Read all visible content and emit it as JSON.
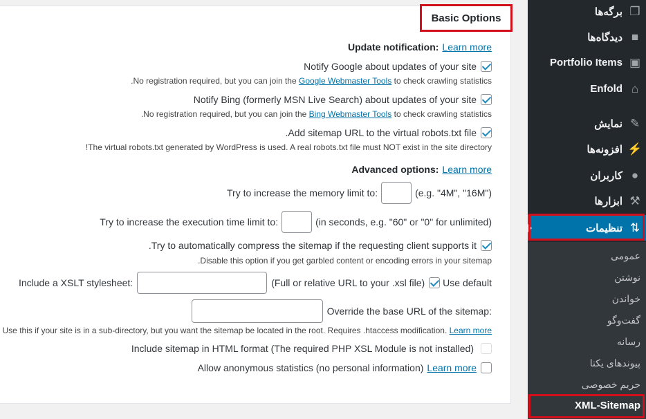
{
  "section_title": "Basic Options",
  "update_notification": {
    "heading": "Update notification:",
    "learn_more": "Learn more",
    "google_label": "Notify Google about updates of your site",
    "google_help_pre": ".No registration required, but you can join the ",
    "google_help_link": "Google Webmaster Tools",
    "google_help_post": " to check crawling statistics",
    "bing_label": "Notify Bing (formerly MSN Live Search) about updates of your site",
    "bing_help_pre": ".No registration required, but you can join the ",
    "bing_help_link": "Bing Webmaster Tools",
    "bing_help_post": " to check crawling statistics",
    "robots_label": ".Add sitemap URL to the virtual robots.txt file",
    "robots_help": "!The virtual robots.txt generated by WordPress is used. A real robots.txt file must NOT exist in the site directory"
  },
  "advanced_options": {
    "heading": "Advanced options:",
    "learn_more": "Learn more",
    "memory_label": "Try to increase the memory limit to:",
    "memory_hint": "(e.g. \"4M\", \"16M\")",
    "memory_value": "",
    "time_label": "Try to increase the execution time limit to:",
    "time_hint": "(in seconds, e.g. \"60\" or \"0\" for unlimited)",
    "time_value": "",
    "compress_label": ".Try to automatically compress the sitemap if the requesting client supports it",
    "compress_help": ".Disable this option if you get garbled content or encoding errors in your sitemap",
    "xslt_label": "Include a XSLT stylesheet:",
    "xslt_value": "",
    "xslt_hint": "(Full or relative URL to your .xsl file)",
    "use_default": "Use default",
    "baseurl_label": "Override the base URL of the sitemap:",
    "baseurl_value": "",
    "baseurl_help": "Use this if your site is in a sub-directory, but you want the sitemap be located in the root. Requires .htaccess modification.",
    "baseurl_learn_more": "Learn more",
    "html_label": "Include sitemap in HTML format (The required PHP XSL Module is not installed)",
    "stats_label": "Allow anonymous statistics (no personal information)",
    "stats_learn_more": "Learn more"
  },
  "sidebar": {
    "items": [
      {
        "label": "برگه‌ها",
        "icon": "pages-icon"
      },
      {
        "label": "دیدگاه‌ها",
        "icon": "comments-icon"
      },
      {
        "label": "Portfolio Items",
        "icon": "portfolio-icon"
      },
      {
        "label": "Enfold",
        "icon": "home-icon"
      },
      {
        "label": "نمایش",
        "icon": "appearance-icon"
      },
      {
        "label": "افزونه‌ها",
        "icon": "plugins-icon"
      },
      {
        "label": "کاربران",
        "icon": "users-icon"
      },
      {
        "label": "ابزارها",
        "icon": "tools-icon"
      },
      {
        "label": "تنظیمات",
        "icon": "settings-icon"
      }
    ],
    "submenu": [
      "عمومی",
      "نوشتن",
      "خواندن",
      "گفت‌وگو",
      "رسانه",
      "پیوندهای یکتا",
      "حریم خصوصی",
      "XML-Sitemap"
    ]
  },
  "colors": {
    "accent": "#0073aa",
    "highlight": "#d1101b",
    "sidebar": "#23282d"
  }
}
